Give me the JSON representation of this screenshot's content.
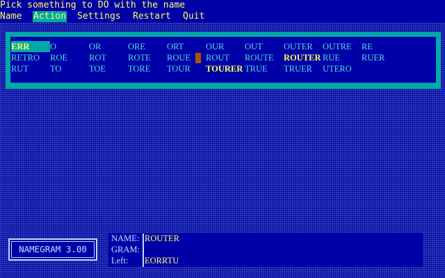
{
  "header": {
    "prompt": "Pick something to DO with the name"
  },
  "menu": {
    "items": [
      {
        "label": "Name"
      },
      {
        "label": "Action"
      },
      {
        "label": "Settings"
      },
      {
        "label": "Restart"
      },
      {
        "label": "Quit"
      }
    ],
    "active": "Action"
  },
  "word_grid": {
    "rows": [
      [
        "ERR",
        "O",
        "OR",
        "ORE",
        "ORT",
        "OUR",
        "OUT",
        "OUTER",
        "OUTRE",
        "RE"
      ],
      [
        "RETRO",
        "ROE",
        "ROT",
        "ROTE",
        "ROUE",
        "ROUT",
        "ROUTE",
        "ROUTER",
        "RUE",
        "RUER"
      ],
      [
        "RUT",
        "TO",
        "TOE",
        "TORE",
        "TOUR",
        "TOURER",
        "TRUE",
        "TRUER",
        "UTERO",
        ""
      ]
    ],
    "selected": "ERR",
    "highlighted": [
      "ROUTER",
      "TOURER"
    ],
    "colors": {
      "normal": "#55d8d8",
      "highlight": "#ffff55",
      "selection_bg": "#00a8a8",
      "cursor": "#aa5500"
    }
  },
  "logo": {
    "text": "NAMEGRAM 3.00"
  },
  "info": {
    "name_label": "NAME:",
    "name_value": "ROUTER",
    "gram_label": "GRAM:",
    "gram_value": "",
    "left_label": "Left:",
    "left_value": "EORRTU"
  },
  "theme": {
    "background": "#0a10a0",
    "panel": "#0000a8",
    "accent": "#00a8a8",
    "text_yellow": "#ffff55"
  }
}
